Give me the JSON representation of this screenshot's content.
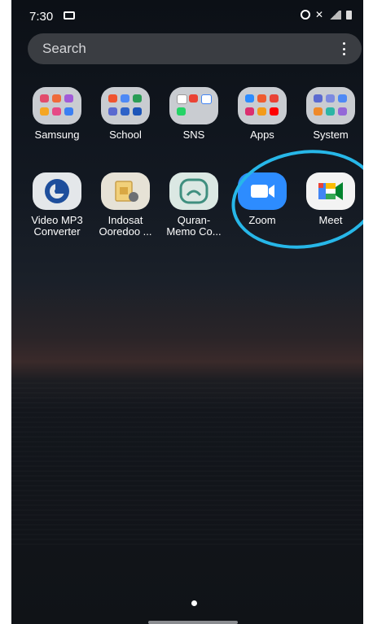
{
  "status_bar": {
    "time": "7:30"
  },
  "search": {
    "placeholder": "Search"
  },
  "folders": [
    {
      "label": "Samsung"
    },
    {
      "label": "School"
    },
    {
      "label": "SNS"
    },
    {
      "label": "Apps"
    },
    {
      "label": "System"
    }
  ],
  "apps": [
    {
      "label": "Video MP3\nConverter"
    },
    {
      "label": "Indosat\nOoredoo ..."
    },
    {
      "label": "Quran-\nMemo Co..."
    },
    {
      "label": "Zoom"
    },
    {
      "label": "Meet"
    }
  ],
  "colors": {
    "highlight_circle": "#27b7e8",
    "zoom_blue": "#2d8cff",
    "search_bg": "#3a3d42"
  }
}
